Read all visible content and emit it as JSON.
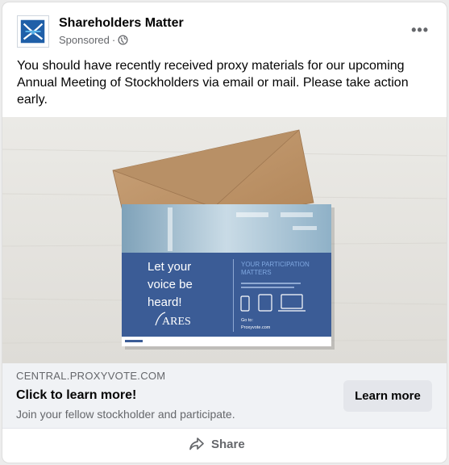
{
  "post": {
    "page_name": "Shareholders Matter",
    "sponsored": "Sponsored",
    "separator": "·",
    "text": "You should have recently received proxy materials for our upcoming Annual Meeting of Stockholders via email or mail. Please take action early.",
    "more_label": "•••"
  },
  "media": {
    "headline_lines": [
      "Let your",
      "voice be",
      "heard!"
    ],
    "brand": "ARES",
    "participation_title_lines": [
      "YOUR PARTICIPATION",
      "MATTERS"
    ],
    "go_to": "Go to:",
    "go_url": "Proxyvote.com"
  },
  "link": {
    "domain": "CENTRAL.PROXYVOTE.COM",
    "headline": "Click to learn more!",
    "description": "Join your fellow stockholder and participate.",
    "cta_label": "Learn more"
  },
  "footer": {
    "share_label": "Share"
  },
  "colors": {
    "card_bg": "#ffffff",
    "link_area_bg": "#f0f2f5",
    "cta_bg": "#e4e6eb",
    "secondary_text": "#65676b",
    "envelope": "#c49a6c",
    "card_blue": "#3b5c96"
  },
  "icons": {
    "avatar": "shareholders-matter-logo",
    "audience": "globe-icon",
    "more": "more-options-icon",
    "share": "share-arrow-icon"
  }
}
